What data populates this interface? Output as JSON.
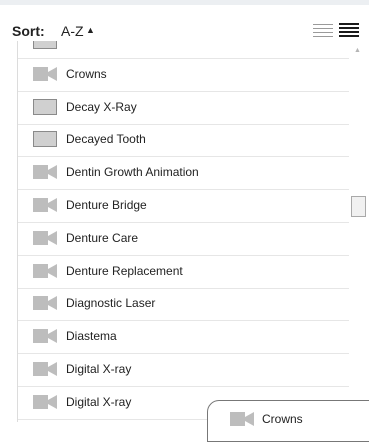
{
  "sort": {
    "label": "Sort:",
    "value": "A-Z",
    "direction_glyph": "▲"
  },
  "view_toggle": [
    {
      "icon": "list-view-icon",
      "active": false
    },
    {
      "icon": "dense-list-view-icon",
      "active": true
    }
  ],
  "items": [
    {
      "label": "",
      "icon": "image-icon"
    },
    {
      "label": "Crowns",
      "icon": "video-icon"
    },
    {
      "label": "Decay X-Ray",
      "icon": "image-icon"
    },
    {
      "label": "Decayed Tooth",
      "icon": "image-icon"
    },
    {
      "label": "Dentin Growth Animation",
      "icon": "video-icon"
    },
    {
      "label": "Denture Bridge",
      "icon": "video-icon"
    },
    {
      "label": "Denture Care",
      "icon": "video-icon"
    },
    {
      "label": "Denture Replacement",
      "icon": "video-icon"
    },
    {
      "label": "Diagnostic Laser",
      "icon": "video-icon"
    },
    {
      "label": "Diastema",
      "icon": "video-icon"
    },
    {
      "label": "Digital X-ray",
      "icon": "video-icon"
    },
    {
      "label": "Digital X-ray",
      "icon": "video-icon"
    }
  ],
  "drag_ghost": {
    "label": "Crowns",
    "icon": "video-icon"
  },
  "colors": {
    "icon_fill": "#bdbdbd",
    "border": "#e6e6e6",
    "text": "#222222"
  }
}
